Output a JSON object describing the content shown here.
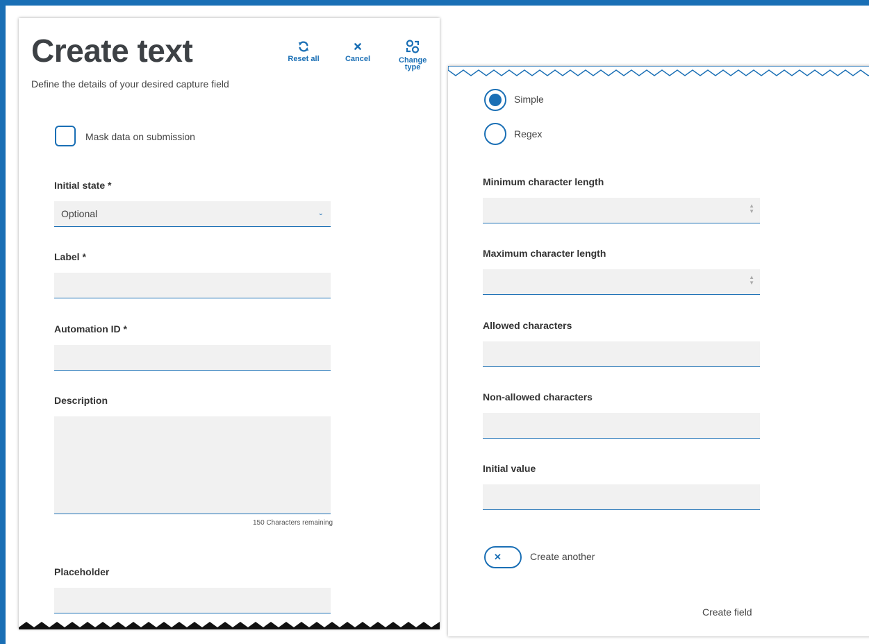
{
  "header": {
    "title": "Create text",
    "subtitle": "Define the details of your desired capture field"
  },
  "toolbar": {
    "reset_label": "Reset all",
    "cancel_label": "Cancel",
    "change_type_label": "Change type"
  },
  "mask": {
    "label": "Mask data on submission",
    "checked": false
  },
  "initial_state": {
    "label": "Initial state *",
    "value": "Optional"
  },
  "label_field": {
    "label": "Label *",
    "value": ""
  },
  "automation_id": {
    "label": "Automation ID *",
    "value": ""
  },
  "description": {
    "label": "Description",
    "value": "",
    "counter": "150 Characters remaining"
  },
  "placeholder_field": {
    "label": "Placeholder",
    "value": ""
  },
  "validation": {
    "options": [
      {
        "label": "Simple",
        "selected": true
      },
      {
        "label": "Regex",
        "selected": false
      }
    ]
  },
  "min_length": {
    "label": "Minimum character length",
    "value": ""
  },
  "max_length": {
    "label": "Maximum character length",
    "value": ""
  },
  "allowed": {
    "label": "Allowed characters",
    "value": ""
  },
  "non_allowed": {
    "label": "Non-allowed characters",
    "value": ""
  },
  "initial_value": {
    "label": "Initial value",
    "value": ""
  },
  "create_another": {
    "label": "Create another",
    "enabled": false
  },
  "create_field_label": "Create field",
  "colors": {
    "accent": "#1a6fb5",
    "input_bg": "#f1f1f1",
    "title": "#3d4145"
  }
}
